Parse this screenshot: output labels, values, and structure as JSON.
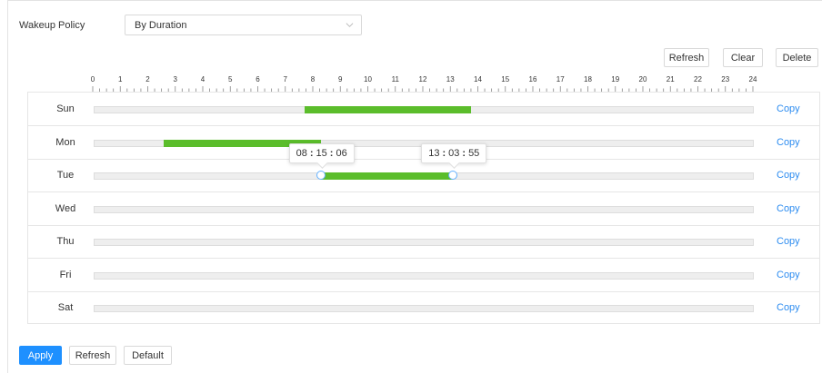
{
  "wakeup_policy": {
    "label": "Wakeup Policy",
    "selected": "By Duration"
  },
  "toolbar": {
    "refresh_label": "Refresh",
    "clear_label": "Clear",
    "delete_label": "Delete"
  },
  "ruler": {
    "hours": [
      "0",
      "1",
      "2",
      "3",
      "4",
      "5",
      "6",
      "7",
      "8",
      "9",
      "10",
      "11",
      "12",
      "13",
      "14",
      "15",
      "16",
      "17",
      "18",
      "19",
      "20",
      "21",
      "22",
      "23",
      "24"
    ]
  },
  "schedule": [
    {
      "day": "Sun",
      "copy": "Copy",
      "segments": [
        [
          7.68,
          13.73
        ]
      ]
    },
    {
      "day": "Mon",
      "copy": "Copy",
      "segments": [
        [
          2.53,
          8.25
        ]
      ]
    },
    {
      "day": "Tue",
      "copy": "Copy",
      "segments": [
        [
          8.2517,
          13.0653
        ]
      ],
      "editing": true
    },
    {
      "day": "Wed",
      "copy": "Copy",
      "segments": []
    },
    {
      "day": "Thu",
      "copy": "Copy",
      "segments": []
    },
    {
      "day": "Fri",
      "copy": "Copy",
      "segments": []
    },
    {
      "day": "Sat",
      "copy": "Copy",
      "segments": []
    }
  ],
  "tooltips": {
    "start": {
      "h": "08",
      "m": "15",
      "s": "06"
    },
    "end": {
      "h": "13",
      "m": "03",
      "s": "55"
    }
  },
  "footer": {
    "apply_label": "Apply",
    "refresh_label": "Refresh",
    "default_label": "Default"
  },
  "colors": {
    "segment": "#5bbd2b",
    "link": "#2d8cf0",
    "primary": "#1e90ff",
    "track": "#eeeeee"
  }
}
